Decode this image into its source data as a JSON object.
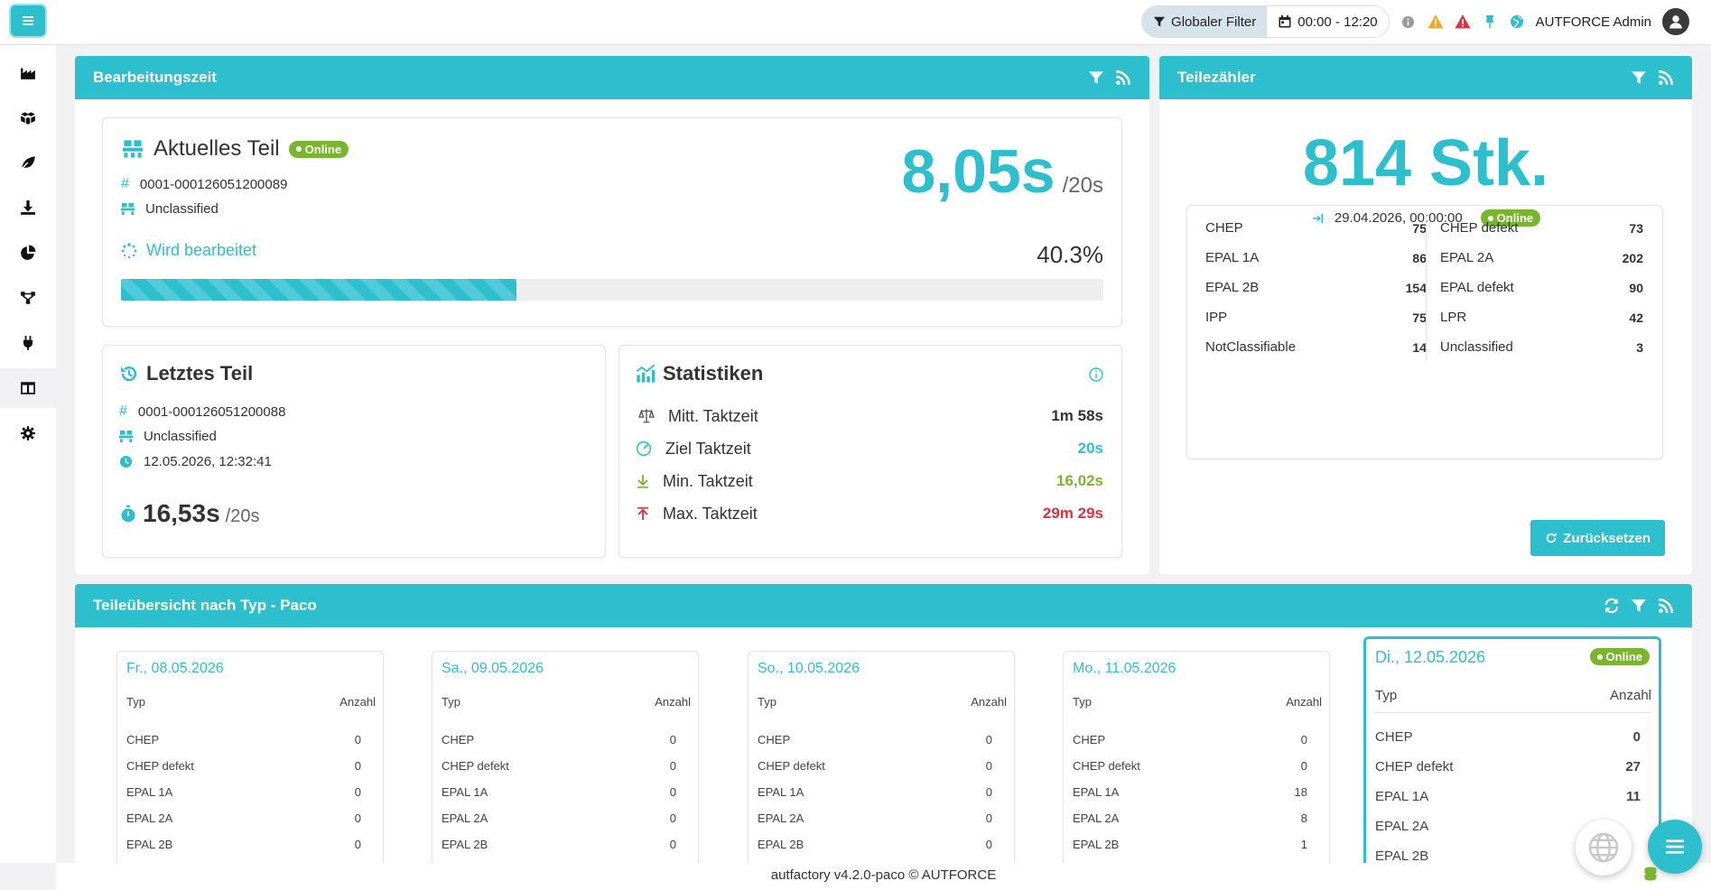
{
  "topbar": {
    "filter_label": "Globaler Filter",
    "time_range": "00:00 - 12:20",
    "user_name": "AUTFORCE Admin"
  },
  "colors": {
    "accent": "#2ebfcf",
    "online": "#7ab52f",
    "min": "#7ab52f",
    "max": "#e0303a",
    "warning": "#f5a623"
  },
  "bearbeitungszeit": {
    "title": "Bearbeitungszeit",
    "current": {
      "title": "Aktuelles Teil",
      "status": "Online",
      "id": "0001-000126051200089",
      "type": "Unclassified",
      "processing_label": "Wird bearbeitet",
      "time": "8,05s",
      "target": "/20s",
      "percent": "40.3%",
      "progress_fraction": 0.403
    },
    "last": {
      "title": "Letztes Teil",
      "id": "0001-000126051200088",
      "type": "Unclassified",
      "timestamp": "12.05.2026, 12:32:41",
      "time": "16,53s",
      "target": "/20s"
    },
    "stats": {
      "title": "Statistiken",
      "rows": [
        {
          "label": "Mitt. Taktzeit",
          "value": "1m 58s"
        },
        {
          "label": "Ziel Taktzeit",
          "value": "20s"
        },
        {
          "label": "Min. Taktzeit",
          "value": "16,02s"
        },
        {
          "label": "Max. Taktzeit",
          "value": "29m 29s"
        }
      ]
    }
  },
  "teilezaehler": {
    "title": "Teilezähler",
    "count": "814 Stk.",
    "since": "29.04.2026, 00:00:00",
    "status": "Online",
    "left": [
      {
        "label": "CHEP",
        "value": "75"
      },
      {
        "label": "EPAL 1A",
        "value": "86"
      },
      {
        "label": "EPAL 2B",
        "value": "154"
      },
      {
        "label": "IPP",
        "value": "75"
      },
      {
        "label": "NotClassifiable",
        "value": "14"
      }
    ],
    "right": [
      {
        "label": "CHEP defekt",
        "value": "73"
      },
      {
        "label": "EPAL 2A",
        "value": "202"
      },
      {
        "label": "EPAL defekt",
        "value": "90"
      },
      {
        "label": "LPR",
        "value": "42"
      },
      {
        "label": "Unclassified",
        "value": "3"
      }
    ],
    "reset_label": "Zurücksetzen"
  },
  "uebersicht": {
    "title": "Teileübersicht nach Typ - Paco",
    "col_type": "Typ",
    "col_count": "Anzahl",
    "days": [
      {
        "date": "Fr., 08.05.2026",
        "rows": [
          {
            "t": "CHEP",
            "n": "0"
          },
          {
            "t": "CHEP defekt",
            "n": "0"
          },
          {
            "t": "EPAL 1A",
            "n": "0"
          },
          {
            "t": "EPAL 2A",
            "n": "0"
          },
          {
            "t": "EPAL 2B",
            "n": "0"
          }
        ]
      },
      {
        "date": "Sa., 09.05.2026",
        "rows": [
          {
            "t": "CHEP",
            "n": "0"
          },
          {
            "t": "CHEP defekt",
            "n": "0"
          },
          {
            "t": "EPAL 1A",
            "n": "0"
          },
          {
            "t": "EPAL 2A",
            "n": "0"
          },
          {
            "t": "EPAL 2B",
            "n": "0"
          }
        ]
      },
      {
        "date": "So., 10.05.2026",
        "rows": [
          {
            "t": "CHEP",
            "n": "0"
          },
          {
            "t": "CHEP defekt",
            "n": "0"
          },
          {
            "t": "EPAL 1A",
            "n": "0"
          },
          {
            "t": "EPAL 2A",
            "n": "0"
          },
          {
            "t": "EPAL 2B",
            "n": "0"
          }
        ]
      },
      {
        "date": "Mo., 11.05.2026",
        "rows": [
          {
            "t": "CHEP",
            "n": "0"
          },
          {
            "t": "CHEP defekt",
            "n": "0"
          },
          {
            "t": "EPAL 1A",
            "n": "18"
          },
          {
            "t": "EPAL 2A",
            "n": "8"
          },
          {
            "t": "EPAL 2B",
            "n": "1"
          }
        ]
      }
    ],
    "today": {
      "date": "Di., 12.05.2026",
      "status": "Online",
      "rows": [
        {
          "t": "CHEP",
          "n": "0"
        },
        {
          "t": "CHEP defekt",
          "n": "27"
        },
        {
          "t": "EPAL 1A",
          "n": "11"
        },
        {
          "t": "EPAL 2A",
          "n": ""
        },
        {
          "t": "EPAL 2B",
          "n": ""
        }
      ]
    }
  },
  "footer": {
    "text": "autfactory v4.2.0-paco © AUTFORCE"
  },
  "icons": {
    "sidebar": [
      "factory-icon",
      "boxes-icon",
      "leaf-icon",
      "download-icon",
      "pie-chart-icon",
      "network-icon",
      "plug-icon",
      "table-icon",
      "settings-icon"
    ]
  }
}
